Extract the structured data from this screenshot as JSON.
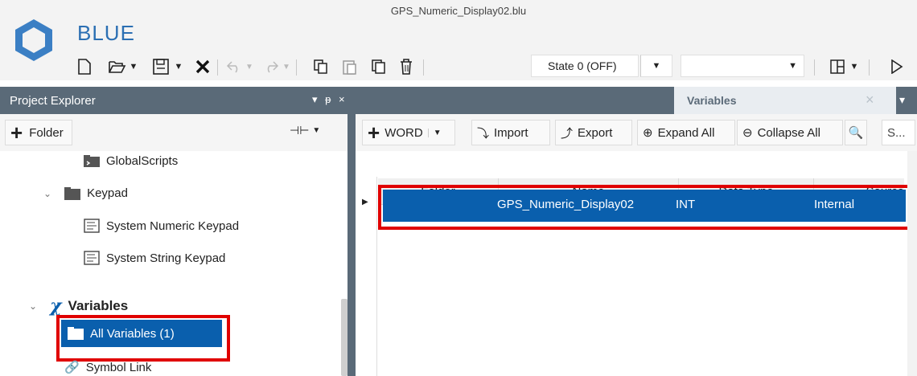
{
  "app": {
    "name": "BLUE",
    "file_name": "GPS_Numeric_Display02.blu"
  },
  "toolbar": {
    "state_value": "State 0 (OFF)",
    "second_value": ""
  },
  "project_explorer": {
    "title": "Project Explorer",
    "controls": "▾ ᵽ ×",
    "folder_button": "Folder",
    "tree": {
      "global_scripts": "GlobalScripts",
      "keypad": "Keypad",
      "system_numeric_keypad": "System Numeric Keypad",
      "system_string_keypad": "System String Keypad",
      "variables": "Variables",
      "all_variables": "All Variables (1)",
      "symbol_link": "Symbol Link"
    }
  },
  "variables_tab": {
    "label": "Variables",
    "toolbar": {
      "word": "WORD",
      "import": "Import",
      "export": "Export",
      "expand_all": "Expand All",
      "collapse_all": "Collapse All",
      "search_placeholder": "S..."
    },
    "columns": [
      "Folder",
      "Name",
      "Data Type",
      "Source"
    ],
    "rows": [
      {
        "folder": "",
        "name": "GPS_Numeric_Display02",
        "data_type": "INT",
        "source": "Internal"
      }
    ]
  },
  "colors": {
    "accent": "#0a5fad",
    "panel_header": "#5a6a78",
    "highlight": "#e00000",
    "brand": "#2b6fb3"
  }
}
